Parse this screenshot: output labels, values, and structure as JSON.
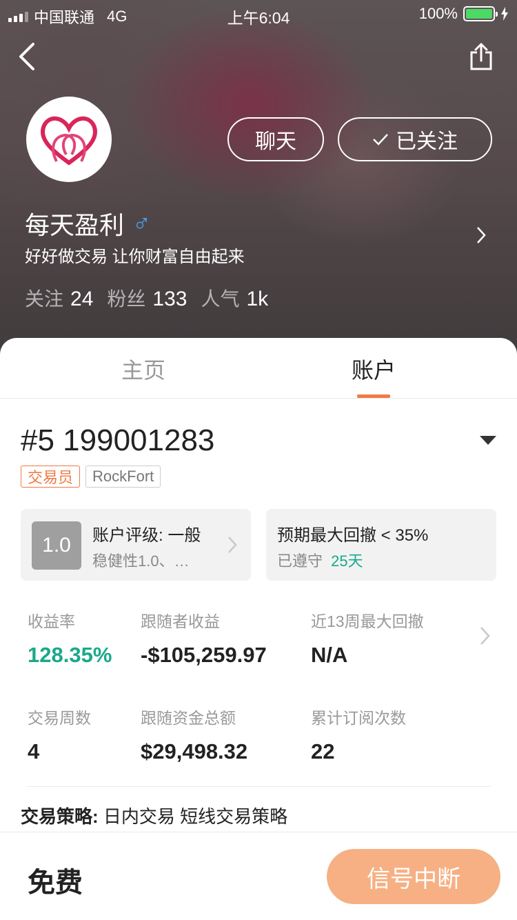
{
  "status_bar": {
    "carrier": "中国联通",
    "network": "4G",
    "time": "上午6:04",
    "battery": "100%"
  },
  "profile": {
    "chat_label": "聊天",
    "follow_label": "已关注",
    "name": "每天盈利",
    "gender_symbol": "♂",
    "bio": "好好做交易 让你财富自由起来",
    "stats": [
      {
        "label": "关注",
        "value": "24"
      },
      {
        "label": "粉丝",
        "value": "133"
      },
      {
        "label": "人气",
        "value": "1k"
      }
    ]
  },
  "tabs": [
    {
      "label": "主页",
      "active": false
    },
    {
      "label": "账户",
      "active": true
    }
  ],
  "account": {
    "id": "#5 199001283",
    "tags": [
      "交易员",
      "RockFort"
    ],
    "rating_score": "1.0",
    "rating_title": "账户评级: 一般",
    "rating_sub": "稳健性1.0、…",
    "drawdown_title": "预期最大回撤 < 35%",
    "drawdown_sub_label": "已遵守",
    "drawdown_days": "25天",
    "metrics": [
      {
        "label": "收益率",
        "value": "128.35%"
      },
      {
        "label": "跟随者收益",
        "value": "-$105,259.97"
      },
      {
        "label": "近13周最大回撤",
        "value": "N/A"
      },
      {
        "label": "交易周数",
        "value": "4"
      },
      {
        "label": "跟随资金总额",
        "value": "$29,498.32"
      },
      {
        "label": "累计订阅次数",
        "value": "22"
      }
    ],
    "strategy_label": "交易策略:",
    "strategy_value": "日内交易 短线交易策略"
  },
  "bottom": {
    "price": "免费",
    "action_label": "信号中断"
  },
  "colors": {
    "accent": "#ef7a45",
    "green": "#1aa88a",
    "button": "#f6b083"
  }
}
